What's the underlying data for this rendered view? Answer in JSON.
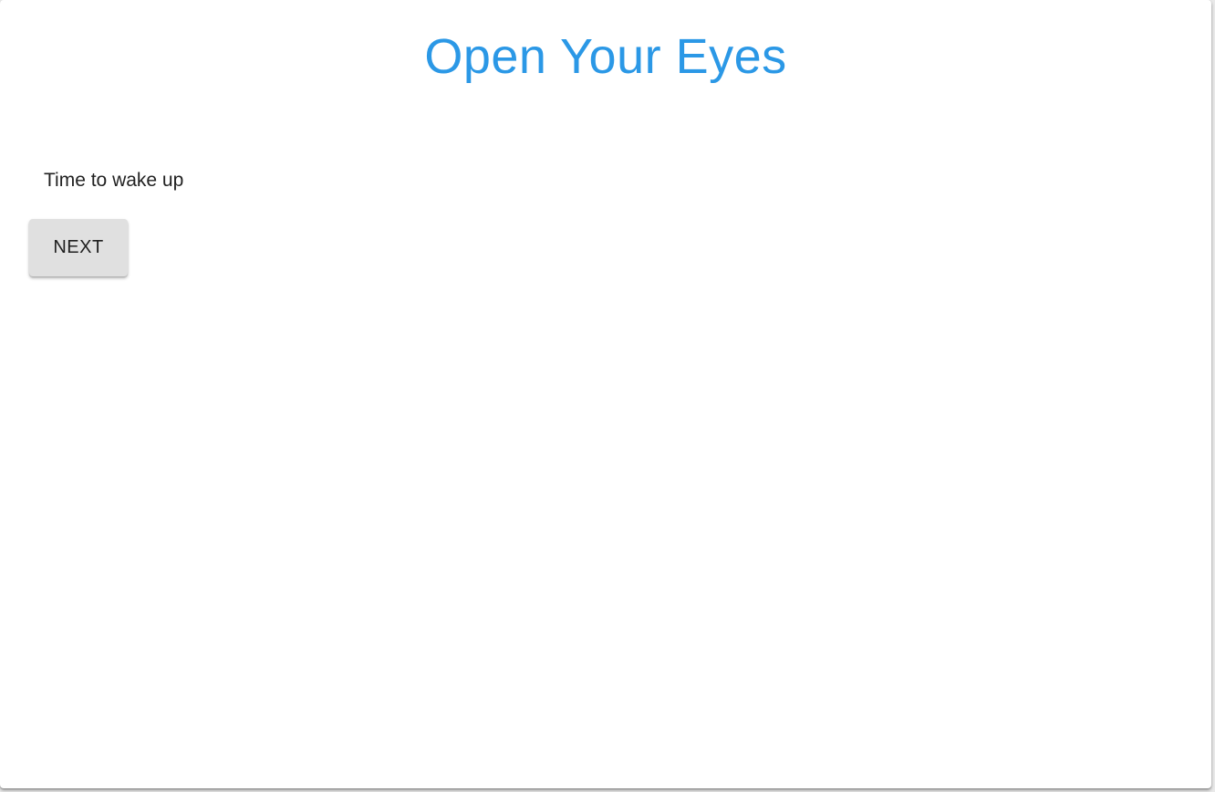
{
  "page": {
    "title": "Open Your Eyes",
    "message": "Time to wake up",
    "next_label": "NEXT"
  },
  "colors": {
    "title": "#2b98e6",
    "button_bg": "#e0e0e0",
    "text": "#222222"
  }
}
